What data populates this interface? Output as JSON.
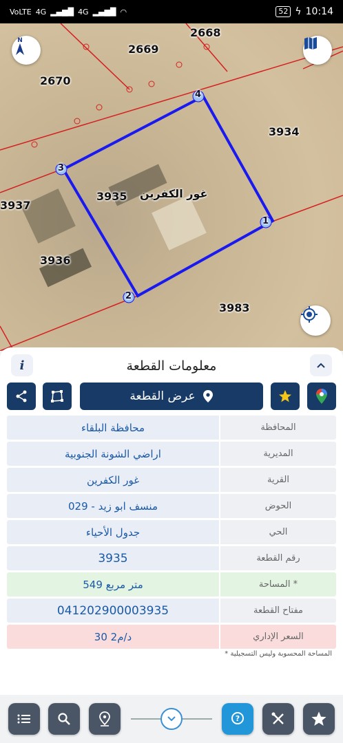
{
  "status": {
    "carrier": "VoLTE",
    "signal1": "4G",
    "signal2": "4G",
    "battery": "52",
    "time": "10:14"
  },
  "map": {
    "labels": {
      "p2668": "2668",
      "p2669": "2669",
      "p2670": "2670",
      "p3934": "3934",
      "p3935": "3935",
      "p3937": "3937",
      "p3936": "3936",
      "p3983": "3983",
      "village": "غور الكفرين"
    },
    "vertices": [
      "1",
      "2",
      "3",
      "4"
    ],
    "compass": "N",
    "icons": {
      "compass": "compass-north-icon",
      "layers": "map-layers-icon",
      "locate": "my-location-icon"
    }
  },
  "panel": {
    "title": "معلومات القطعة",
    "info_label": "i",
    "show_parcel_label": "عرض القطعة",
    "rows": [
      {
        "key": "المحافظة",
        "value": "محافظة البلقاء"
      },
      {
        "key": "المديرية",
        "value": "اراضي الشونة الجنوبية"
      },
      {
        "key": "القرية",
        "value": "غور الكفرين"
      },
      {
        "key": "الحوض",
        "value": "منسف ابو زيد - 029"
      },
      {
        "key": "الحي",
        "value": "جدول الأحياء"
      },
      {
        "key": "رقم القطعة",
        "value": "3935"
      },
      {
        "key": "المساحة *",
        "value": "549  متر مربع"
      },
      {
        "key": "مفتاح القطعة",
        "value": "041202900003935"
      },
      {
        "key": "السعر الإداري",
        "value": "30 د/م2"
      }
    ],
    "footnote": "* المساحة المحسوبة وليس التسجيلية"
  },
  "colors": {
    "navy": "#183a66",
    "accent": "#2196d8",
    "parcel_outline": "#1a1aee",
    "boundary_red": "#d42020"
  }
}
